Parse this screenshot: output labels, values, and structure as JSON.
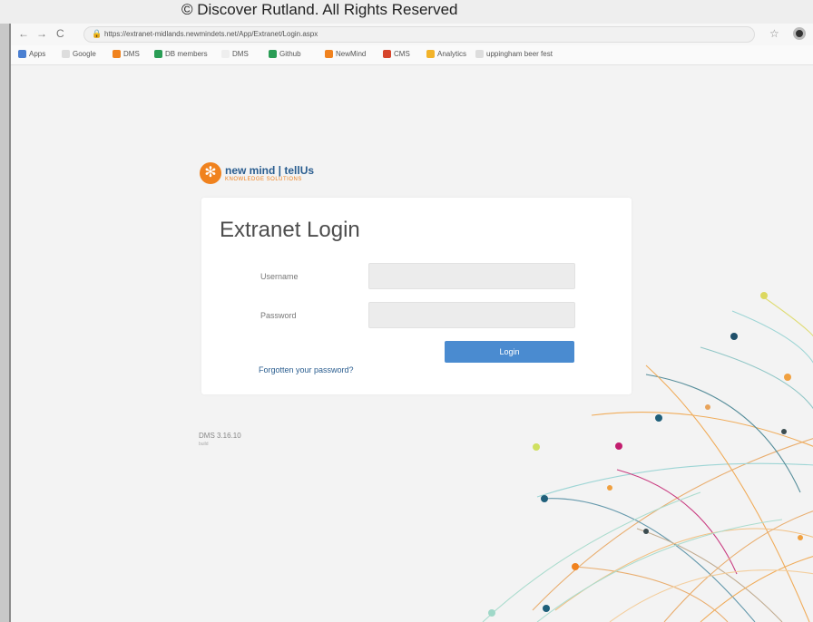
{
  "copyright": "© Discover Rutland. All Rights Reserved",
  "browser": {
    "nav": {
      "back": "←",
      "forward": "→",
      "reload": "C"
    },
    "url": "https://extranet-midlands.newmindets.net/App/Extranet/Login.aspx",
    "bookmarks": [
      {
        "label": "Apps",
        "color": "#4a7fd1"
      },
      {
        "label": "Google",
        "color": "#dddddd"
      },
      {
        "label": "DMS",
        "color": "#f0821e"
      },
      {
        "label": "DB members",
        "color": "#2a9d55"
      },
      {
        "label": "DMS",
        "color": "#eeeeee"
      },
      {
        "label": "Github",
        "color": "#2a9d55"
      },
      {
        "label": "NewMind",
        "color": "#f0821e"
      },
      {
        "label": "CMS",
        "color": "#d6452b"
      },
      {
        "label": "Analytics",
        "color": "#f2b32a"
      },
      {
        "label": "uppingham beer fest",
        "color": "#dddddd"
      }
    ]
  },
  "brand": {
    "name": "new mind | tellUs",
    "tagline": "KNOWLEDGE SOLUTIONS",
    "mark": "✻"
  },
  "login": {
    "title": "Extranet Login",
    "username_label": "Username",
    "password_label": "Password",
    "username_value": "",
    "password_value": "",
    "login_button": "Login",
    "forgot_link": "Forgotten your password?"
  },
  "version": "DMS 3.16.10",
  "version_sub": "build",
  "colors": {
    "accent": "#4a8bd0",
    "brand_orange": "#f0821e",
    "link": "#2a5d8f"
  }
}
